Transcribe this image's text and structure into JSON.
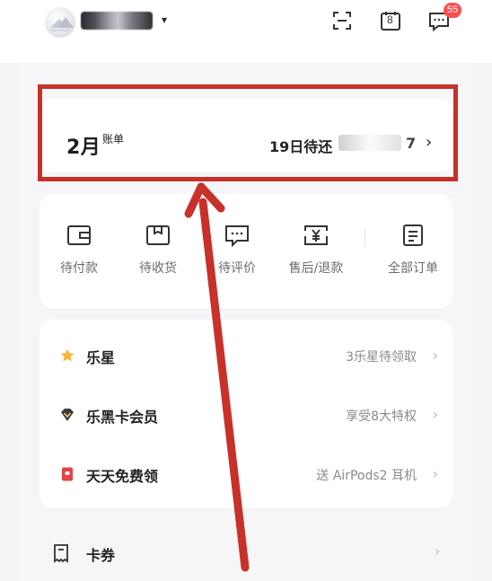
{
  "header": {
    "avatar": "avatar-image",
    "account_caret": "▾",
    "icons": [
      "scan-icon",
      "calendar-icon",
      "message-icon"
    ],
    "calendar_day": "8",
    "message_badge": "55"
  },
  "bill": {
    "month": "2月",
    "suffix": "账单",
    "due_text": "19日待还",
    "amount_tail": "7",
    "chevron": "›"
  },
  "orders": [
    {
      "label": "待付款",
      "icon": "wallet-icon"
    },
    {
      "label": "待收货",
      "icon": "package-icon"
    },
    {
      "label": "待评价",
      "icon": "comment-icon"
    },
    {
      "label": "售后/退款",
      "icon": "refund-icon"
    },
    {
      "label": "全部订单",
      "icon": "order-list-icon"
    }
  ],
  "menu": [
    {
      "title": "乐星",
      "value": "3乐星待领取",
      "icon": "star-icon",
      "color": "#f5b63b"
    },
    {
      "title": "乐黑卡会员",
      "value": "享受8大特权",
      "icon": "diamond-icon",
      "color": "#3a3a3f"
    },
    {
      "title": "天天免费领",
      "value": "送 AirPods2 耳机",
      "icon": "gift-icon",
      "color": "#e54345"
    }
  ],
  "coupon": {
    "title": "卡券",
    "icon": "coupon-icon"
  },
  "annotation": {
    "color": "#c8302a"
  }
}
